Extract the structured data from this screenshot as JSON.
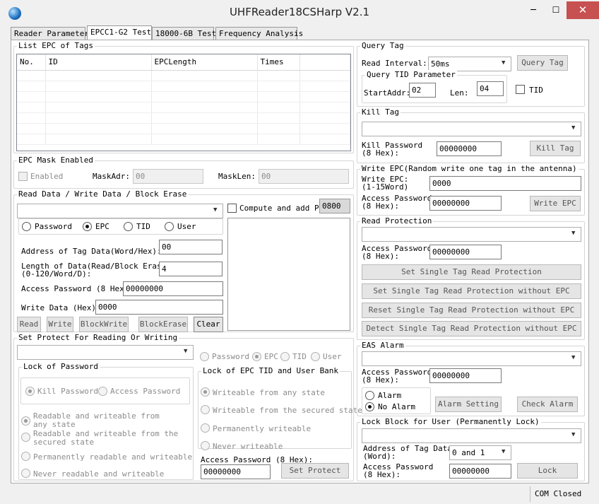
{
  "window": {
    "title": "UHFReader18CSHarp V2.1",
    "min": "─",
    "max": "☐",
    "close": "✕"
  },
  "tabs": [
    {
      "label": "Reader Parameter"
    },
    {
      "label": "EPCC1-G2 Test"
    },
    {
      "label": "18000-6B Test"
    },
    {
      "label": "Frequency Analysis"
    }
  ],
  "list_epc": {
    "title": "List EPC of Tags",
    "columns": [
      "No.",
      "ID",
      "EPCLength",
      "Times"
    ]
  },
  "mask": {
    "title": "EPC Mask Enabled",
    "enabled_label": "Enabled",
    "maskadr_label": "MaskAdr:",
    "maskadr_value": "00",
    "masklen_label": "MaskLen:",
    "masklen_value": "00"
  },
  "rw": {
    "title": "Read Data / Write Data / Block Erase",
    "combo_value": "",
    "compute_label": "Compute and add PC",
    "pc_value": "0800",
    "mem_options": [
      "Password",
      "EPC",
      "TID",
      "User"
    ],
    "address_label": "Address of Tag Data(Word/Hex):",
    "address_value": "00",
    "length_label_1": "Length of Data(Read/Block Erase)",
    "length_label_2": "(0-120/Word/D):",
    "length_value": "4",
    "access_label": "Access Password (8 Hex):",
    "access_value": "00000000",
    "write_label": "Write Data (Hex):",
    "write_value": "0000",
    "read_btn": "Read",
    "write_btn": "Write",
    "blockwrite_btn": "BlockWrite",
    "blockerase_btn": "BlockErase",
    "clear_btn": "Clear"
  },
  "protect": {
    "title": "Set Protect For Reading Or Writing",
    "combo_value": "",
    "mem_options": [
      "Password",
      "EPC",
      "TID",
      "User"
    ],
    "lock_password_title": "Lock of Password",
    "kill_password": "Kill Password",
    "access_password": "Access Password",
    "pw_options": [
      {
        "line1": "Readable and  writeable from",
        "line2": "any state"
      },
      {
        "line1": "Readable and writeable from the",
        "line2": "secured state"
      },
      {
        "line1": "Permanently readable and writeable",
        "line2": ""
      },
      {
        "line1": "Never readable and writeable",
        "line2": ""
      }
    ],
    "lock_bank_title": "Lock of EPC TID and User Bank",
    "bank_options": [
      "Writeable from any state",
      "Writeable from the secured state",
      "Permanently writeable",
      "Never writeable"
    ],
    "access_label": "Access Password (8 Hex):",
    "access_value": "00000000",
    "set_btn": "Set Protect"
  },
  "query": {
    "title": "Query Tag",
    "interval_label": "Read Interval:",
    "interval_value": "50ms",
    "query_btn": "Query Tag",
    "tid_title": "Query TID Parameter",
    "startaddr_label": "StartAddr:",
    "startaddr_value": "02",
    "len_label": "Len:",
    "len_value": "04",
    "tid_check": "TID"
  },
  "kill": {
    "title": "Kill Tag",
    "combo_value": "",
    "pw_label_1": "Kill Password",
    "pw_label_2": "(8 Hex):",
    "pw_value": "00000000",
    "kill_btn": "Kill Tag"
  },
  "write_epc": {
    "title": "Write EPC(Random write one tag in the antenna)",
    "epc_label_1": "Write EPC:",
    "epc_label_2": "(1-15Word)",
    "epc_value": "0000",
    "pw_label_1": "Access Password",
    "pw_label_2": "(8 Hex):",
    "pw_value": "00000000",
    "write_btn": "Write EPC"
  },
  "read_protection": {
    "title": "Read Protection",
    "combo_value": "",
    "pw_label_1": "Access Password",
    "pw_label_2": "(8 Hex):",
    "pw_value": "00000000",
    "btn1": "Set Single Tag Read Protection",
    "btn2": "Set Single Tag Read Protection without EPC",
    "btn3": "Reset Single Tag Read Protection without EPC",
    "btn4": "Detect Single Tag Read Protection without EPC"
  },
  "eas": {
    "title": "EAS Alarm",
    "combo_value": "",
    "pw_label_1": "Access Password",
    "pw_label_2": "(8 Hex):",
    "pw_value": "00000000",
    "alarm": "Alarm",
    "no_alarm": "No Alarm",
    "setting_btn": "Alarm Setting",
    "check_btn": "Check Alarm"
  },
  "lock_block": {
    "title": "Lock Block for User (Permanently Lock)",
    "combo_value": "",
    "addr_label_1": "Address of Tag Data",
    "addr_label_2": "(Word):",
    "addr_value": "0 and 1",
    "pw_label_1": "Access Password",
    "pw_label_2": "(8 Hex):",
    "pw_value": "00000000",
    "lock_btn": "Lock"
  },
  "status": {
    "com": "COM Closed"
  },
  "icons": {
    "app": "globe-icon",
    "dropdown": "chevron-down-icon"
  },
  "colors": {
    "close_button": "#c75050",
    "window_bg": "#f0f0f0",
    "panel_bg": "#ffffff"
  }
}
